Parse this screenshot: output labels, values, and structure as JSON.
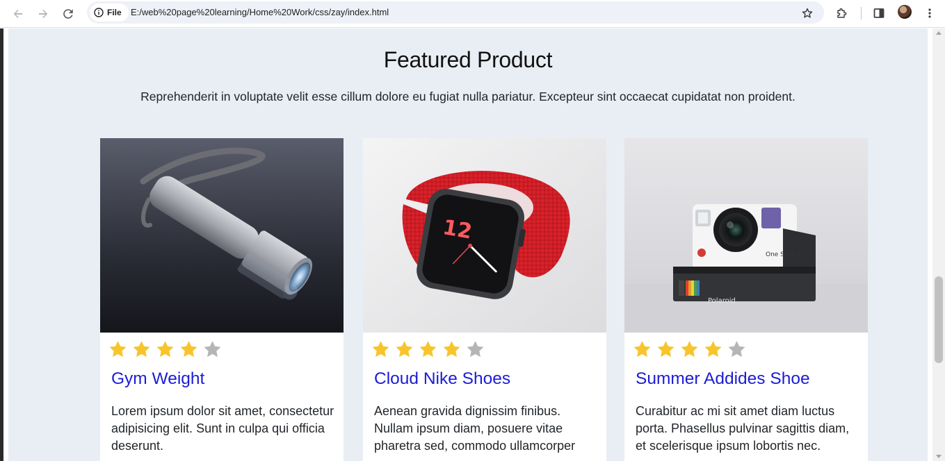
{
  "browser": {
    "file_label": "File",
    "url": "E:/web%20page%20learning/Home%20Work/css/zay/index.html"
  },
  "featured": {
    "title": "Featured Product",
    "description": "Reprehenderit in voluptate velit esse cillum dolore eu fugiat nulla pariatur. Excepteur sint occaecat cupidatat non proident.",
    "products": [
      {
        "name": "Gym Weight",
        "description": "Lorem ipsum dolor sit amet, consectetur adipisicing elit. Sunt in culpa qui officia deserunt.",
        "image": "flashlight",
        "rating": 4,
        "rating_max": 5
      },
      {
        "name": "Cloud Nike Shoes",
        "description": "Aenean gravida dignissim finibus. Nullam ipsum diam, posuere vitae pharetra sed, commodo ullamcorper",
        "image": "smartwatch",
        "watch_face": "12",
        "rating": 4,
        "rating_max": 5
      },
      {
        "name": "Summer Addides Shoe",
        "description": "Curabitur ac mi sit amet diam luctus porta. Phasellus pulvinar sagittis diam, et scelerisque ipsum lobortis nec.",
        "image": "instant-camera",
        "camera_brand": "Polaroid",
        "camera_model": "One Step 2",
        "rating": 4,
        "rating_max": 5
      }
    ]
  },
  "colors": {
    "star_filled": "#f7c52b",
    "star_empty": "#b5b5b5",
    "title_link": "#1c1cd6",
    "section_bg": "#e9eef5"
  }
}
